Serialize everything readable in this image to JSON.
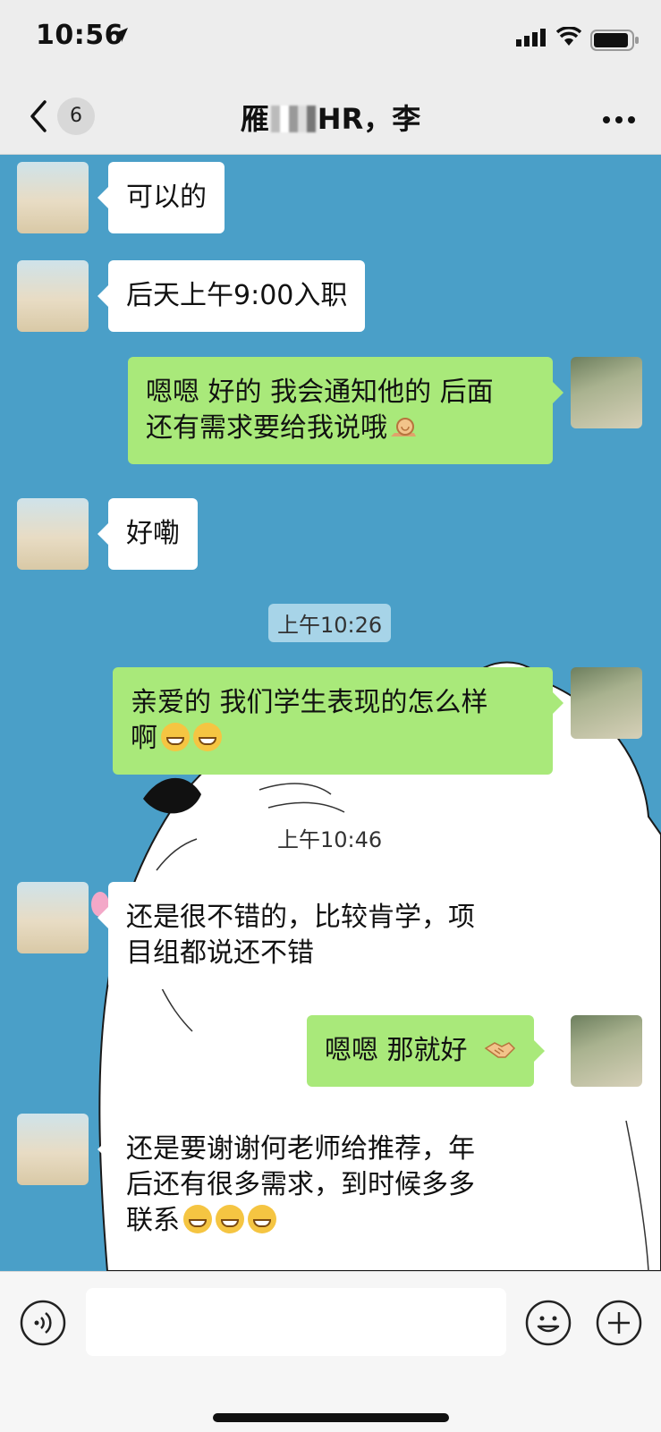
{
  "status_bar": {
    "time": "10:56"
  },
  "nav": {
    "unread_count": "6",
    "title_prefix": "雁",
    "title_suffix": "HR，李"
  },
  "messages": [
    {
      "side": "left",
      "text": "可以的"
    },
    {
      "side": "left",
      "text": "后天上午9:00入职"
    },
    {
      "side": "right",
      "line1": "嗯嗯 好的 我会通知他的 后面",
      "line2": "还有需求要给我说哦"
    },
    {
      "side": "left",
      "text": "好嘞"
    },
    {
      "side": "time",
      "text": "上午10:26"
    },
    {
      "side": "right",
      "line1": "亲爱的 我们学生表现的怎么样",
      "line2": "啊"
    },
    {
      "side": "time",
      "text": "上午10:46"
    },
    {
      "side": "left",
      "line1": "还是很不错的，比较肯学，项",
      "line2": "目组都说还不错"
    },
    {
      "side": "right",
      "text": "嗯嗯 那就好"
    },
    {
      "side": "left",
      "line1": "还是要谢谢何老师给推荐，年",
      "line2": "后还有很多需求，到时候多多",
      "line3": "联系"
    }
  ],
  "input": {
    "placeholder": ""
  },
  "icons": {
    "back": "chevron-left-icon",
    "more": "more-dots-icon",
    "voice": "voice-icon",
    "emoji": "emoji-face-icon",
    "plus": "plus-circle-icon",
    "grin": "grin-emoji",
    "snail": "snail-emoji",
    "handshake": "handshake-emoji"
  },
  "colors": {
    "chat_bg": "#4a9fc8",
    "sent_bubble": "#a9e97a",
    "received_bubble": "#ffffff",
    "bar_bg": "#ededed"
  }
}
